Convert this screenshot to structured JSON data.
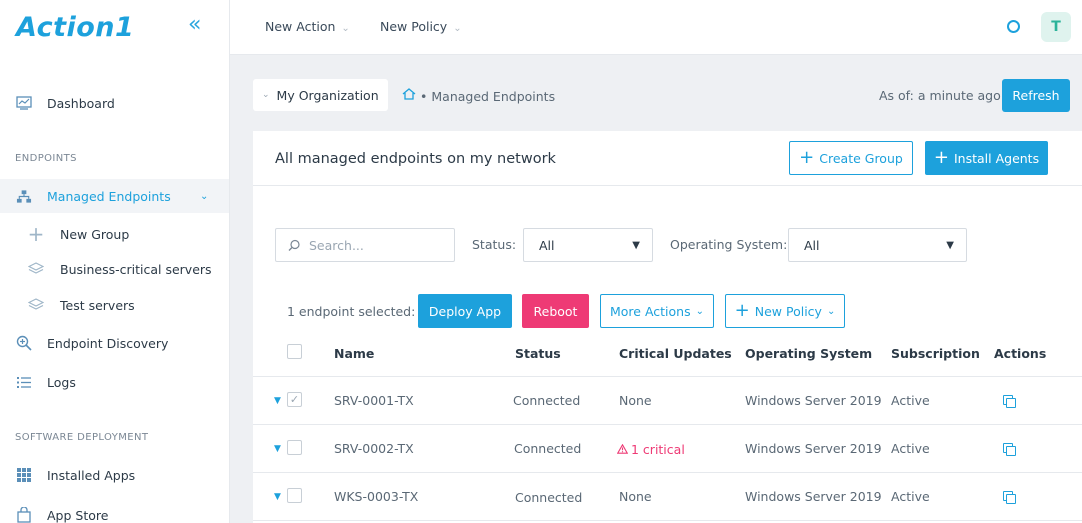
{
  "app": {
    "logo": "Action1",
    "collapse_icon": "double-chevron-left-icon"
  },
  "sidebar": {
    "sections": {
      "endpoints": "ENDPOINTS",
      "software": "SOFTWARE DEPLOYMENT"
    },
    "items": [
      {
        "label": "Dashboard",
        "icon": "dashboard-icon"
      },
      {
        "label": "Managed Endpoints",
        "icon": "network-icon"
      },
      {
        "label": "New Group",
        "icon": "plus-icon"
      },
      {
        "label": "Business-critical servers",
        "icon": "layers-icon"
      },
      {
        "label": "Test servers",
        "icon": "layers-icon"
      },
      {
        "label": "Endpoint Discovery",
        "icon": "search-zoom-icon"
      },
      {
        "label": "Logs",
        "icon": "list-icon"
      },
      {
        "label": "Installed Apps",
        "icon": "grid-icon"
      },
      {
        "label": "App Store",
        "icon": "bag-icon"
      }
    ]
  },
  "topbar": {
    "menu": [
      "New Action",
      "New Policy"
    ],
    "avatar": "T"
  },
  "breadcrumb": {
    "org": "My Organization",
    "current": "Managed Endpoints",
    "as_of": "As of: a minute ago",
    "refresh": "Refresh"
  },
  "panel": {
    "title": "All managed endpoints on my network",
    "create_group": "Create Group",
    "install_agents": "Install Agents"
  },
  "filters": {
    "search_placeholder": "Search...",
    "status_label": "Status:",
    "status_value": "All",
    "os_label": "Operating System:",
    "os_value": "All"
  },
  "actions": {
    "selected_text": "1 endpoint selected:",
    "deploy_app": "Deploy App",
    "reboot": "Reboot",
    "more_actions": "More Actions",
    "new_policy": "New Policy"
  },
  "table": {
    "columns": [
      "Name",
      "Status",
      "Critical Updates",
      "Operating System",
      "Subscription",
      "Actions"
    ],
    "rows": [
      {
        "name": "SRV-0001-TX",
        "status": "Connected",
        "critical": "None",
        "os": "Windows Server 2019",
        "subscription": "Active",
        "checked": true
      },
      {
        "name": "SRV-0002-TX",
        "status": "Connected",
        "critical": "1 critical",
        "os": "Windows Server 2019",
        "subscription": "Active",
        "checked": false
      },
      {
        "name": "WKS-0003-TX",
        "status": "Connected",
        "critical": "None",
        "os": "Windows Server 2019",
        "subscription": "Active",
        "checked": false
      }
    ]
  },
  "colors": {
    "accent": "#1da1dc",
    "danger": "#ee3a75",
    "text": "#2c3a47"
  }
}
